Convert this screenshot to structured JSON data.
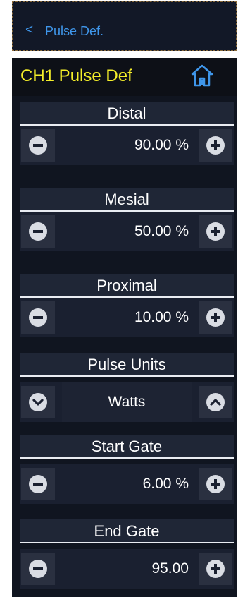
{
  "nav": {
    "back_label": "<",
    "title": "Pulse Def."
  },
  "header": {
    "title": "CH1 Pulse Def"
  },
  "controls": [
    {
      "label": "Distal",
      "value": "90.00 %"
    },
    {
      "label": "Mesial",
      "value": "50.00 %"
    },
    {
      "label": "Proximal",
      "value": "10.00 %"
    },
    {
      "label": "Pulse Units",
      "value": "Watts"
    },
    {
      "label": "Start Gate",
      "value": "6.00 %"
    },
    {
      "label": "End Gate",
      "value": "95.00"
    }
  ],
  "colors": {
    "accent_blue": "#3f96ea",
    "title_yellow": "#f5ef2a",
    "panel_bg": "#101520"
  },
  "icons": {
    "back": "chevron-left-icon",
    "home": "home-icon",
    "decrement": "minus-circle-icon",
    "increment": "plus-circle-icon",
    "select_prev": "chevron-down-circle-icon",
    "select_next": "chevron-up-circle-icon"
  }
}
